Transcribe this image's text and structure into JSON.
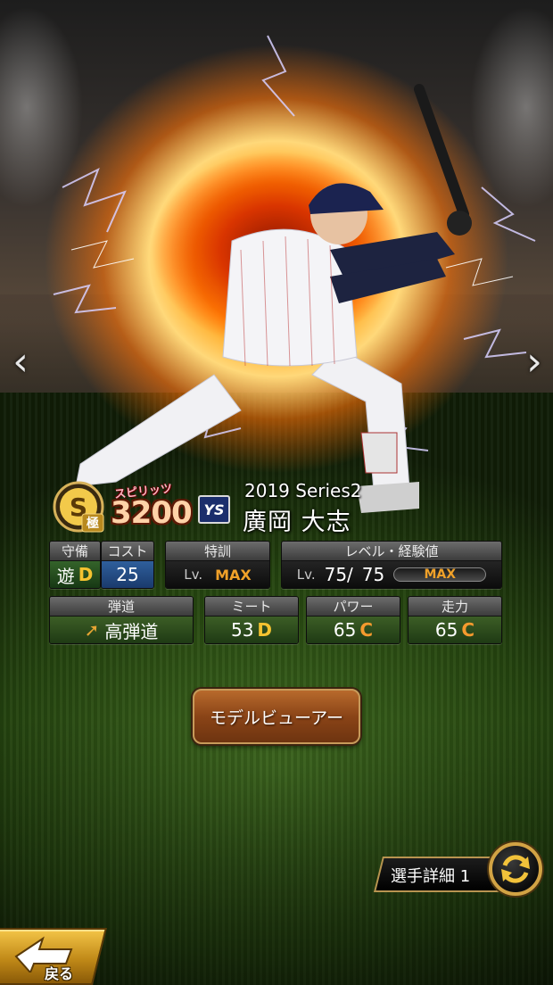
{
  "player": {
    "series": "2019 Series2",
    "name": "廣岡 大志",
    "team_logo_text": "YS"
  },
  "rank": {
    "letter": "S",
    "sub": "極"
  },
  "spirits": {
    "label": "スピリッツ",
    "value": "3200"
  },
  "defense": {
    "header": "守備",
    "position": "遊",
    "grade": "D"
  },
  "cost": {
    "header": "コスト",
    "value": "25"
  },
  "training": {
    "header": "特訓",
    "lv_label": "Lv.",
    "value": "MAX"
  },
  "level": {
    "header": "レベル・経験値",
    "lv_label": "Lv.",
    "current": "75/",
    "max": "75",
    "exp_label": "MAX",
    "exp_fraction": 1.0
  },
  "trajectory": {
    "header": "弾道",
    "value": "高弾道"
  },
  "meet": {
    "header": "ミート",
    "value": "53",
    "grade": "D"
  },
  "power": {
    "header": "パワー",
    "value": "65",
    "grade": "C"
  },
  "speed": {
    "header": "走力",
    "value": "65",
    "grade": "C"
  },
  "buttons": {
    "model_viewer": "モデルビューアー",
    "player_detail": "選手詳細 1",
    "back": "戻る"
  },
  "nav": {
    "prev": "‹",
    "next": "›"
  },
  "colors": {
    "grade_D": "#f4c230",
    "grade_C": "#f59a2e",
    "max_orange": "#f0a129",
    "button_brown": "#8a4417",
    "back_gold": "#f4c548"
  }
}
